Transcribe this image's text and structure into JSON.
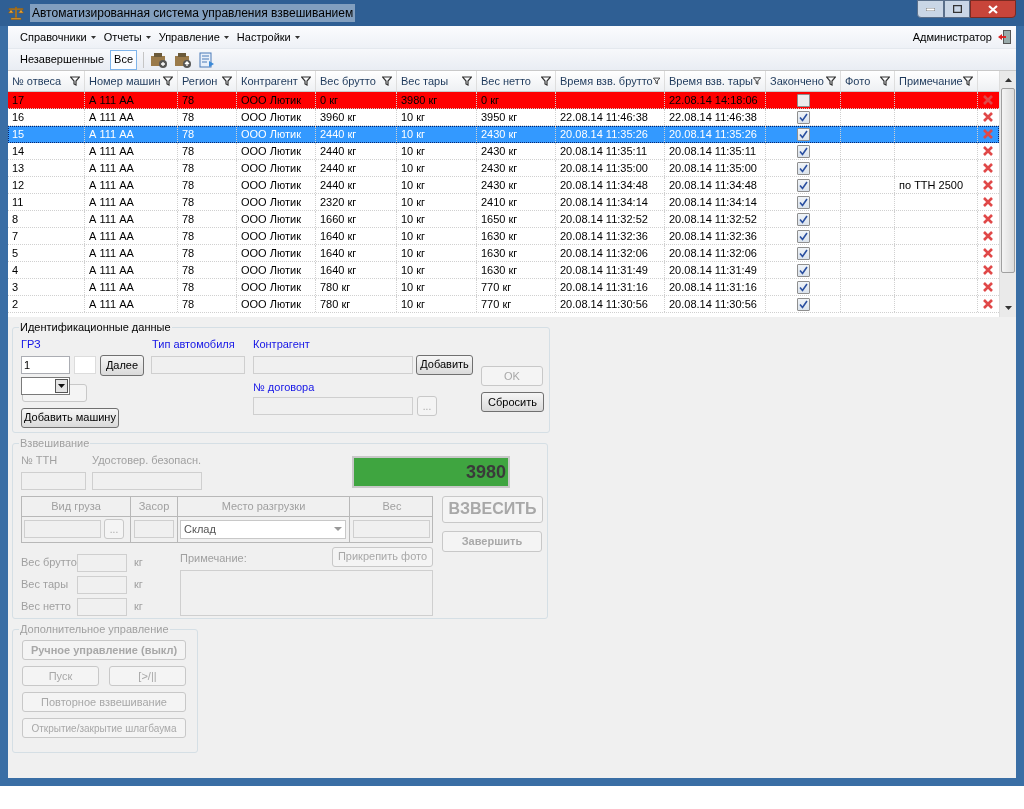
{
  "window": {
    "title": "Автоматизированная система управления взвешиванием"
  },
  "menu": [
    {
      "label": "Справочники",
      "has_dropdown": true
    },
    {
      "label": "Отчеты",
      "has_dropdown": true
    },
    {
      "label": "Управление",
      "has_dropdown": true
    },
    {
      "label": "Настройки",
      "has_dropdown": true
    }
  ],
  "user": "Администратор",
  "toolbar": {
    "filters": [
      {
        "label": "Незавершенные",
        "selected": false
      },
      {
        "label": "Все",
        "selected": true
      }
    ]
  },
  "table": {
    "columns": [
      "№ отвеса",
      "Номер машин",
      "Регион",
      "Контрагент",
      "Вес брутто",
      "Вес тары",
      "Вес нетто",
      "Время взв. брутто",
      "Время взв. тары",
      "Закончено",
      "Фото",
      "Примечание"
    ],
    "rows": [
      {
        "cells": [
          "17",
          "А 111 АА",
          "78",
          "ООО Лютик",
          "0 кг",
          "3980 кг",
          "0 кг",
          "",
          "22.08.14 14:18:06"
        ],
        "done": false,
        "note": "",
        "flagged": true,
        "selected": false
      },
      {
        "cells": [
          "16",
          "А 111 АА",
          "78",
          "ООО Лютик",
          "3960 кг",
          "10 кг",
          "3950 кг",
          "22.08.14 11:46:38",
          "22.08.14 11:46:38"
        ],
        "done": true,
        "note": "",
        "flagged": false,
        "selected": false
      },
      {
        "cells": [
          "15",
          "А 111 АА",
          "78",
          "ООО Лютик",
          "2440 кг",
          "10 кг",
          "2430 кг",
          "20.08.14 11:35:26",
          "20.08.14 11:35:26"
        ],
        "done": true,
        "note": "",
        "flagged": false,
        "selected": true
      },
      {
        "cells": [
          "14",
          "А 111 АА",
          "78",
          "ООО Лютик",
          "2440 кг",
          "10 кг",
          "2430 кг",
          "20.08.14 11:35:11",
          "20.08.14 11:35:11"
        ],
        "done": true,
        "note": "",
        "flagged": false,
        "selected": false
      },
      {
        "cells": [
          "13",
          "А 111 АА",
          "78",
          "ООО Лютик",
          "2440 кг",
          "10 кг",
          "2430 кг",
          "20.08.14 11:35:00",
          "20.08.14 11:35:00"
        ],
        "done": true,
        "note": "",
        "flagged": false,
        "selected": false
      },
      {
        "cells": [
          "12",
          "А 111 АА",
          "78",
          "ООО Лютик",
          "2440 кг",
          "10 кг",
          "2430 кг",
          "20.08.14 11:34:48",
          "20.08.14 11:34:48"
        ],
        "done": true,
        "note": "по ТТН 2500",
        "flagged": false,
        "selected": false
      },
      {
        "cells": [
          "11",
          "А 111 АА",
          "78",
          "ООО Лютик",
          "2320 кг",
          "10 кг",
          "2410 кг",
          "20.08.14 11:34:14",
          "20.08.14 11:34:14"
        ],
        "done": true,
        "note": "",
        "flagged": false,
        "selected": false
      },
      {
        "cells": [
          "8",
          "А 111 АА",
          "78",
          "ООО Лютик",
          "1660 кг",
          "10 кг",
          "1650 кг",
          "20.08.14 11:32:52",
          "20.08.14 11:32:52"
        ],
        "done": true,
        "note": "",
        "flagged": false,
        "selected": false
      },
      {
        "cells": [
          "7",
          "А 111 АА",
          "78",
          "ООО Лютик",
          "1640 кг",
          "10 кг",
          "1630 кг",
          "20.08.14 11:32:36",
          "20.08.14 11:32:36"
        ],
        "done": true,
        "note": "",
        "flagged": false,
        "selected": false
      },
      {
        "cells": [
          "5",
          "А 111 АА",
          "78",
          "ООО Лютик",
          "1640 кг",
          "10 кг",
          "1630 кг",
          "20.08.14 11:32:06",
          "20.08.14 11:32:06"
        ],
        "done": true,
        "note": "",
        "flagged": false,
        "selected": false
      },
      {
        "cells": [
          "4",
          "А 111 АА",
          "78",
          "ООО Лютик",
          "1640 кг",
          "10 кг",
          "1630 кг",
          "20.08.14 11:31:49",
          "20.08.14 11:31:49"
        ],
        "done": true,
        "note": "",
        "flagged": false,
        "selected": false
      },
      {
        "cells": [
          "3",
          "А 111 АА",
          "78",
          "ООО Лютик",
          "780 кг",
          "10 кг",
          "770 кг",
          "20.08.14 11:31:16",
          "20.08.14 11:31:16"
        ],
        "done": true,
        "note": "",
        "flagged": false,
        "selected": false
      },
      {
        "cells": [
          "2",
          "А 111 АА",
          "78",
          "ООО Лютик",
          "780 кг",
          "10 кг",
          "770 кг",
          "20.08.14 11:30:56",
          "20.08.14 11:30:56"
        ],
        "done": true,
        "note": "",
        "flagged": false,
        "selected": false
      }
    ]
  },
  "identification": {
    "legend": "Идентификационные данные",
    "plate_label": "ГРЗ",
    "plate_value": "1",
    "next_button": "Далее",
    "car_type_label": "Тип автомобиля",
    "contractor_label": "Контрагент",
    "add_button": "Добавить",
    "contract_label": "№ договора",
    "contract_browse": "...",
    "add_car_button": "Добавить машину",
    "ok_button": {
      "label": "OK",
      "disabled": true
    },
    "reset_button": {
      "label": "Сбросить",
      "disabled": false
    }
  },
  "weighing": {
    "legend": "Взвешивание",
    "disabled": true,
    "ttn_label": "№ ТТН",
    "safety_label": "Удостовер. безопасн.",
    "display": "3980",
    "grid_headers": [
      "Вид груза",
      "Засор",
      "Место разгрузки",
      "Вес"
    ],
    "cargo_browse": "...",
    "unload_place": "Склад",
    "weigh_button": "ВЗВЕСИТЬ",
    "finish_button": "Завершить",
    "weights": [
      {
        "label": "Вес брутто",
        "unit": "кг"
      },
      {
        "label": "Вес тары",
        "unit": "кг"
      },
      {
        "label": "Вес нетто",
        "unit": "кг"
      }
    ],
    "note_label": "Примечание:",
    "attach_photo_button": "Прикрепить фото"
  },
  "extra": {
    "legend": "Дополнительное управление",
    "disabled": true,
    "manual_button": "Ручное управление (выкл)",
    "start_button": "Пуск",
    "pause_button": "[>/||",
    "reweigh_button": "Повторное взвешивание",
    "barrier_button": "Открытие/закрытие шлагбаума"
  }
}
